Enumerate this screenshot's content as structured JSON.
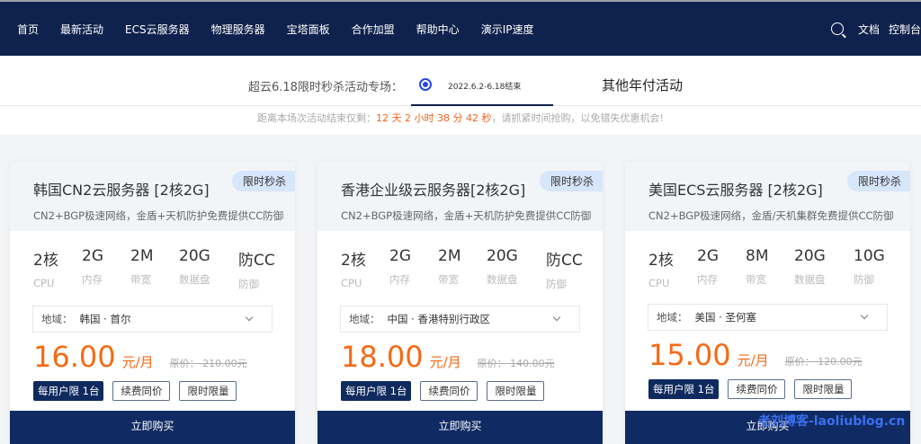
{
  "nav": {
    "items": [
      "首页",
      "最新活动",
      "ECS云服务器",
      "物理服务器",
      "宝塔面板",
      "合作加盟",
      "帮助中心",
      "演示IP速度"
    ],
    "right": [
      "文档",
      "控制台"
    ]
  },
  "activity": {
    "label": "超云6.18限时秒杀活动专场：",
    "date": "2022.6.2-6.18结束",
    "other_tab": "其他年付活动"
  },
  "countdown": {
    "prefix": "距离本场次活动结束仅剩：",
    "time": "12 天 2 小时 38 分 42 秒",
    "suffix": "，请抓紧时间抢购，以免错失优惠机会!"
  },
  "cards": [
    {
      "title": "韩国CN2云服务器 [2核2G]",
      "badge": "限时秒杀",
      "desc": "CN2+BGP极速网络，金盾+天机防护免费提供CC防御",
      "specs": [
        {
          "v": "2核",
          "l": "CPU"
        },
        {
          "v": "2G",
          "l": "内存"
        },
        {
          "v": "2M",
          "l": "带宽"
        },
        {
          "v": "20G",
          "l": "数据盘"
        },
        {
          "v": "防CC",
          "l": "防御"
        }
      ],
      "region_label": "地域：",
      "region": "韩国 · 首尔",
      "price": "16.00",
      "unit": "元/月",
      "orig": "原价：  210.00元",
      "tags": [
        "每用户限 1台",
        "续费同价",
        "限时限量"
      ],
      "buy": "立即购买"
    },
    {
      "title": "香港企业级云服务器[2核2G]",
      "badge": "限时秒杀",
      "desc": "CN2+BGP极速网络，金盾+天机防护免费提供CC防御",
      "specs": [
        {
          "v": "2核",
          "l": "CPU"
        },
        {
          "v": "2G",
          "l": "内存"
        },
        {
          "v": "2M",
          "l": "带宽"
        },
        {
          "v": "20G",
          "l": "数据盘"
        },
        {
          "v": "防CC",
          "l": "防御"
        }
      ],
      "region_label": "地域：",
      "region": "中国 · 香港特别行政区",
      "price": "18.00",
      "unit": "元/月",
      "orig": "原价：  140.00元",
      "tags": [
        "每用户限 1台",
        "续费同价",
        "限时限量"
      ],
      "buy": "立即购买"
    },
    {
      "title": "美国ECS云服务器 [2核2G]",
      "badge": "限时秒杀",
      "desc": "CN2+BGP极速网络，金盾/天机集群免费提供CC防御",
      "specs": [
        {
          "v": "2核",
          "l": "CPU"
        },
        {
          "v": "2G",
          "l": "内存"
        },
        {
          "v": "8M",
          "l": "带宽"
        },
        {
          "v": "20G",
          "l": "数据盘"
        },
        {
          "v": "10G",
          "l": "防御"
        }
      ],
      "region_label": "地域：",
      "region": "美国 · 圣何塞",
      "price": "15.00",
      "unit": "元/月",
      "orig": "原价：  120.00元",
      "tags": [
        "每用户限 1台",
        "续费同价",
        "限时限量"
      ],
      "buy": "立即购买"
    }
  ],
  "watermark": "老刘博客-laoliublog.cn",
  "colors": {
    "nav": "#0f224d",
    "accent": "#f56a14",
    "buy": "#102b63"
  }
}
